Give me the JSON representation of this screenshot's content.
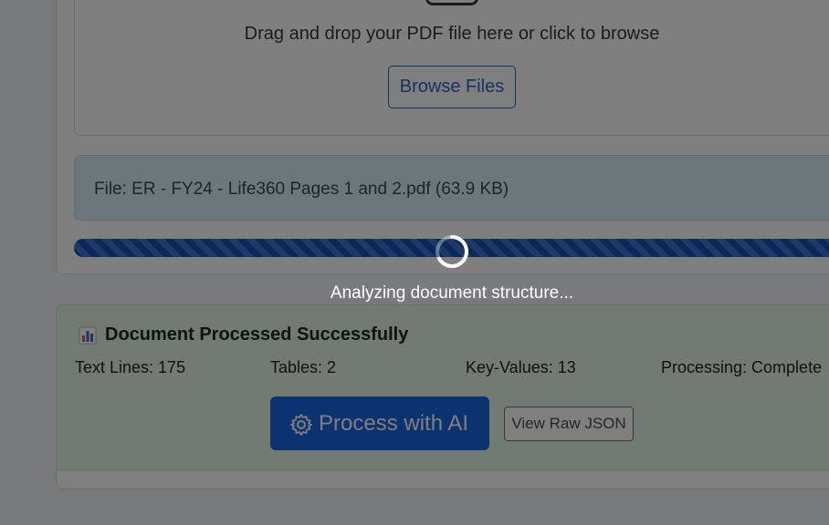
{
  "upload": {
    "drop_text": "Drag and drop your PDF file here or click to browse",
    "browse_label": "Browse Files"
  },
  "file": {
    "info": "File: ER - FY24 - Life360 Pages 1 and 2.pdf (63.9 KB)"
  },
  "progress": {
    "percent": 100
  },
  "results": {
    "icon": "bar-chart-icon",
    "title": "Document Processed Successfully",
    "stats": {
      "text_lines": "Text Lines: 175",
      "tables": "Tables: 2",
      "key_values": "Key-Values: 13",
      "processing": "Processing: Complete"
    },
    "process_ai_label": "Process with AI",
    "view_json_label": "View Raw JSON"
  },
  "overlay": {
    "loading_text": "Analyzing document structure..."
  },
  "colors": {
    "primary": "#1a64e0",
    "success_bg": "#e3f4e6",
    "info_bg": "#d6eef5"
  }
}
